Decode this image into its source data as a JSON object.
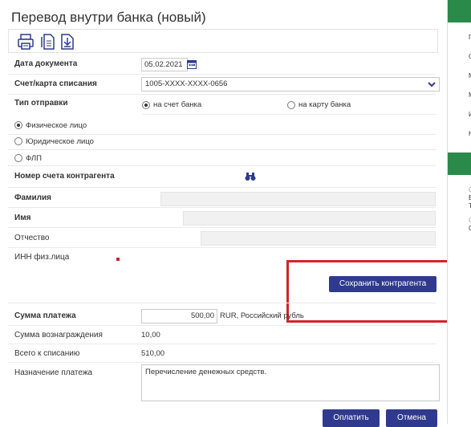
{
  "title": "Перевод внутри банка (новый)",
  "toolbar": {
    "icons": [
      "printer-icon",
      "document-icon",
      "download-icon"
    ]
  },
  "form": {
    "doc_date_label": "Дата документа",
    "doc_date_value": "05.02.2021",
    "account_label": "Счет/карта списания",
    "account_value": "1005-XXXX-XXXX-0656",
    "send_type_label": "Тип отправки",
    "send_type_options": [
      {
        "label": "на счет банка",
        "selected": true
      },
      {
        "label": "на карту банка",
        "selected": false
      }
    ],
    "person_types": [
      {
        "label": "Физическое лицо",
        "selected": true
      },
      {
        "label": "Юридическое лицо",
        "selected": false
      },
      {
        "label": "ФЛП",
        "selected": false
      }
    ],
    "counterparty_account_label": "Номер счета контрагента",
    "surname_label": "Фамилия",
    "name_label": "Имя",
    "patronymic_label": "Отчество",
    "inn_label": "ИНН физ.лица",
    "save_counterparty_button": "Сохранить контрагента",
    "amount_label": "Сумма платежа",
    "amount_value": "500,00",
    "currency_text": "RUR, Российский рубль",
    "fee_label": "Сумма вознаграждения",
    "fee_value": "10,00",
    "total_label": "Всего к списанию",
    "total_value": "510,00",
    "purpose_label": "Назначение платежа",
    "purpose_value": "Перечисление денежных средств."
  },
  "actions": {
    "pay": "Оплатить",
    "cancel": "Отмена"
  },
  "side_panel": {
    "top_letters": [
      "П",
      "С",
      "М",
      "М",
      "И",
      "Н"
    ],
    "lower_letters": [
      "С",
      "Е",
      "Т",
      "С",
      "С"
    ]
  },
  "colors": {
    "primary_button": "#2f3a8f",
    "highlight_frame": "#d5232a",
    "side_header": "#2a8a4a"
  }
}
